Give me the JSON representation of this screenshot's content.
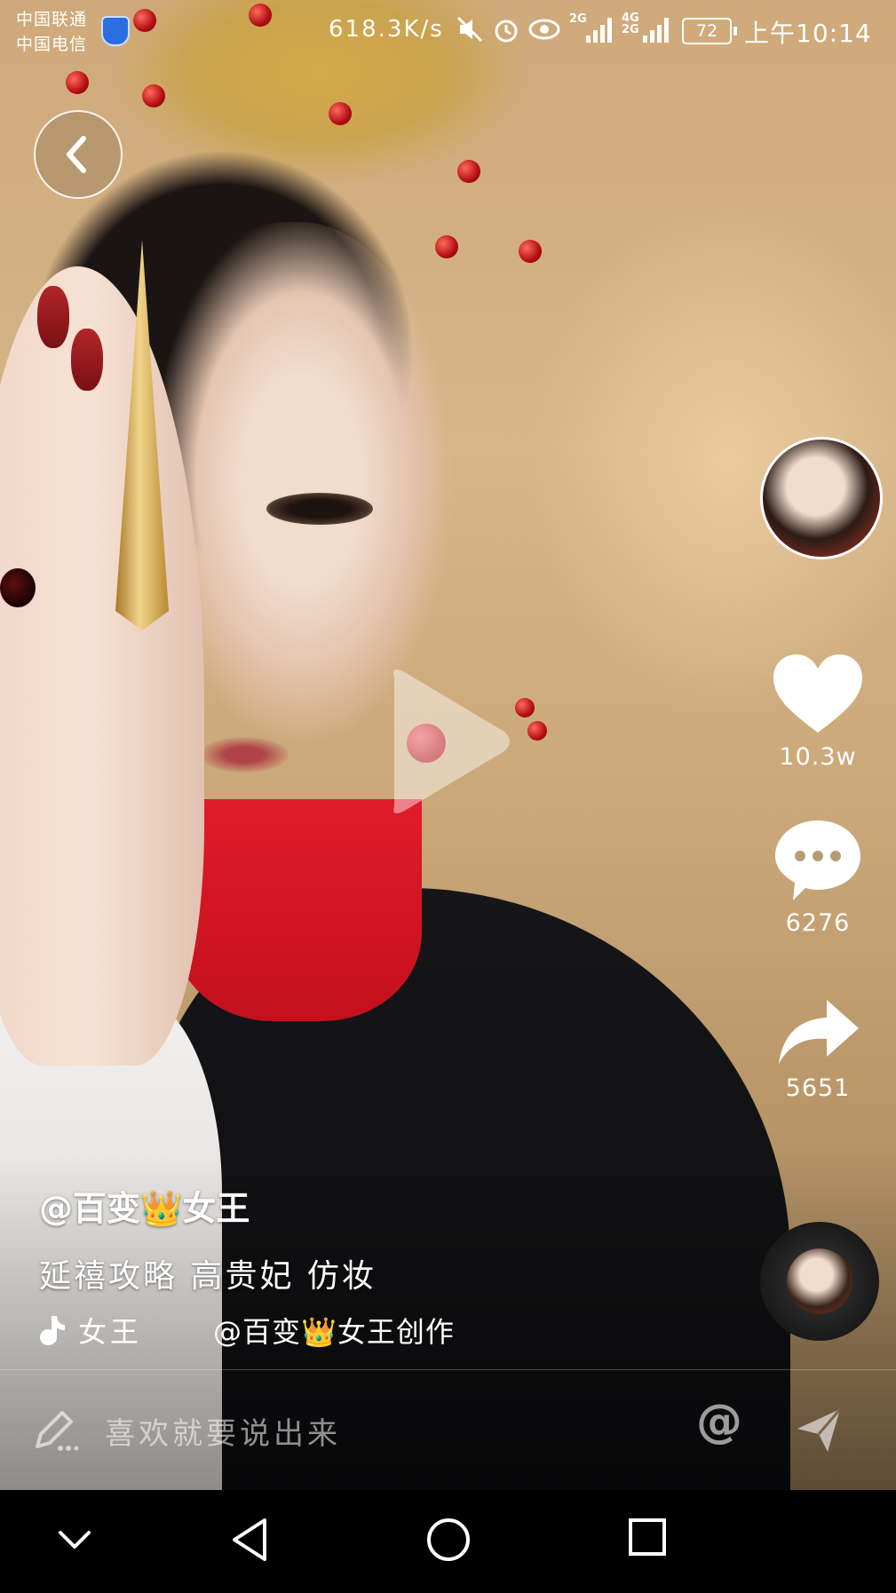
{
  "status_bar": {
    "carrier_1": "中国联通",
    "carrier_2": "中国电信",
    "net_speed": "618.3K/s",
    "signal_1_label": "2G",
    "signal_2_label": "4G 2G",
    "battery": "72",
    "time": "上午10:14"
  },
  "video": {
    "like_count": "10.3w",
    "comment_count": "6276",
    "share_count": "5651"
  },
  "caption": {
    "author": "@百变👑女王",
    "description": "延禧攻略 高贵妃 仿妆",
    "music_title": "女王",
    "music_credit": "@百变👑女王创作"
  },
  "comment_bar": {
    "placeholder": "喜欢就要说出来",
    "at_symbol": "@"
  },
  "icons": [
    "back-icon",
    "play-icon",
    "heart-icon",
    "comment-icon",
    "share-icon",
    "music-note-icon",
    "pen-icon",
    "at-icon",
    "send-icon",
    "nav-down-icon",
    "nav-back-icon",
    "nav-home-icon",
    "nav-recents-icon"
  ]
}
